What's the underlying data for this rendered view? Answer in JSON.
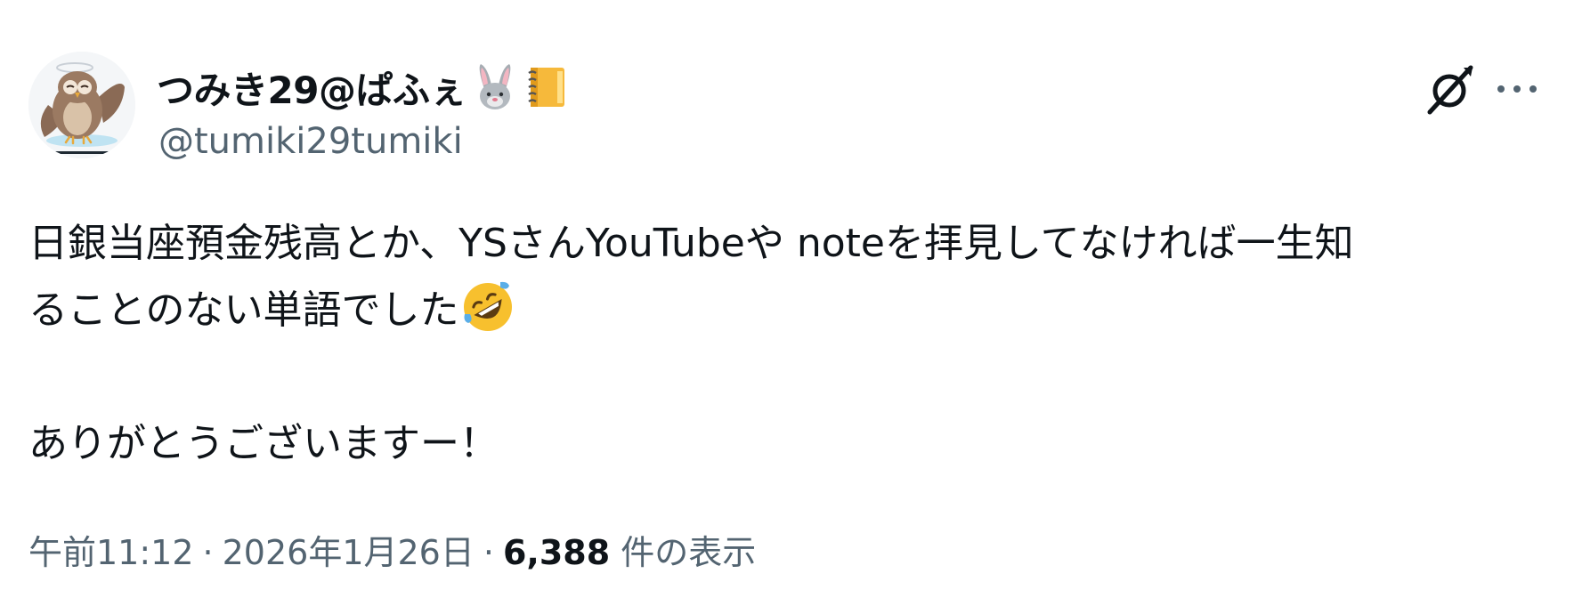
{
  "author": {
    "display_name": "つみき29@ぱふぇ",
    "name_emojis": [
      "rabbit-face-emoji",
      "notebook-emoji"
    ],
    "handle": "@tumiki29tumiki",
    "avatar": "owl-avatar"
  },
  "actions": {
    "grok_icon": "grok-icon",
    "more_icon": "more-icon"
  },
  "tweet": {
    "line1": "日銀当座預金残高とか、YSさんYouTubeや noteを拝見してなければ一生知",
    "line2": "ることのない単語でした",
    "line2_emoji": "rolling-on-floor-laughing-emoji",
    "line3": "ありがとうございますー！"
  },
  "meta": {
    "time": "午前11:12",
    "separator": "·",
    "date": "2026年1月26日",
    "views_count": "6,388",
    "views_label": "件の表示"
  },
  "colors": {
    "text": "#0f1419",
    "secondary": "#536471",
    "background": "#ffffff"
  }
}
